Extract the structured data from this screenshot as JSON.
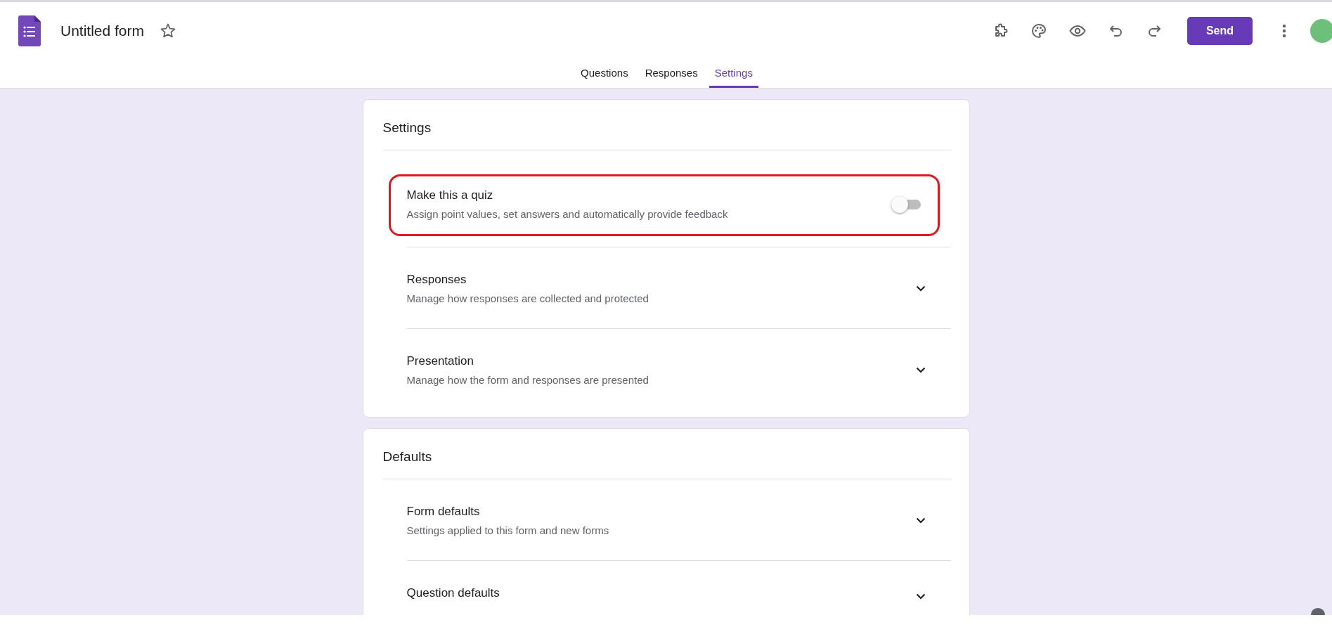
{
  "header": {
    "title": "Untitled form",
    "starred": false,
    "send_button": "Send"
  },
  "tabs": [
    {
      "label": "Questions",
      "selected": false
    },
    {
      "label": "Responses",
      "selected": false
    },
    {
      "label": "Settings",
      "selected": true
    }
  ],
  "cards": [
    {
      "title": "Settings",
      "items": [
        {
          "kind": "toggle",
          "title": "Make this a quiz",
          "description": "Assign point values, set answers and automatically provide feedback",
          "on": false,
          "highlighted": true
        },
        {
          "kind": "expandable",
          "title": "Responses",
          "description": "Manage how responses are collected and protected",
          "expanded": false,
          "highlighted": false
        },
        {
          "kind": "expandable",
          "title": "Presentation",
          "description": "Manage how the form and responses are presented",
          "expanded": false,
          "highlighted": false
        }
      ]
    },
    {
      "title": "Defaults",
      "items": [
        {
          "kind": "expandable",
          "title": "Form defaults",
          "description": "Settings applied to this form and new forms",
          "expanded": false,
          "highlighted": false
        },
        {
          "kind": "expandable",
          "title": "Question defaults",
          "expanded": false,
          "highlighted": false
        }
      ]
    }
  ]
}
